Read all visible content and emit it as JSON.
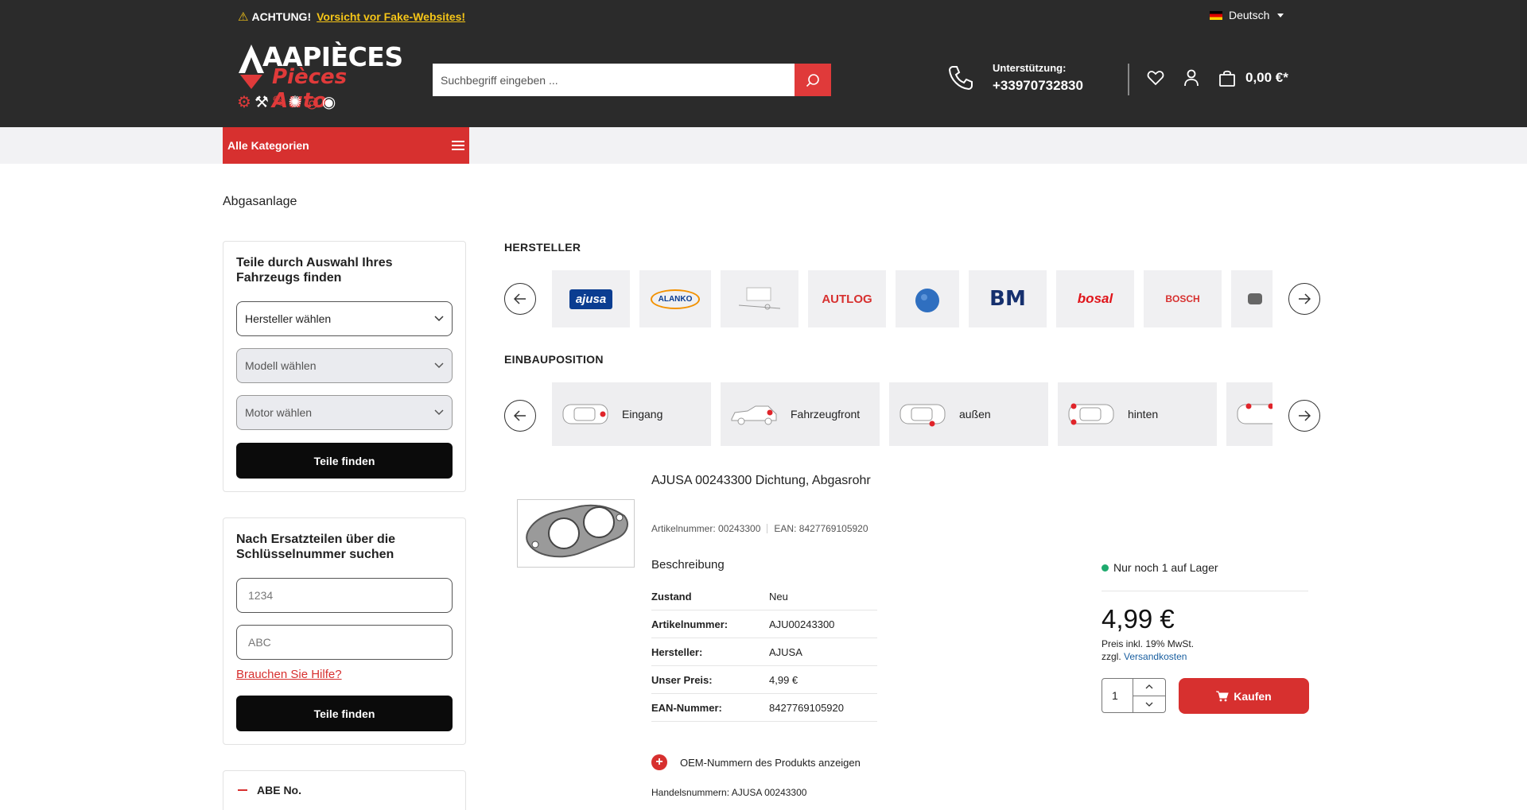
{
  "topbar": {
    "warning_label": "ACHTUNG!",
    "warning_link": "Vorsicht vor Fake-Websites!",
    "language": "Deutsch"
  },
  "logo": {
    "title": "AAPIÈCES",
    "subtitle": "Pièces Auto"
  },
  "search": {
    "placeholder": "Suchbegriff eingeben ..."
  },
  "support": {
    "label": "Unterstützung:",
    "phone": "+33970732830"
  },
  "cart": {
    "total": "0,00 €*"
  },
  "nav": {
    "all_categories": "Alle Kategorien"
  },
  "page": {
    "title": "Abgasanlage"
  },
  "vehicle_finder": {
    "heading": "Teile durch Auswahl Ihres Fahrzeugs finden",
    "manufacturer": "Hersteller wählen",
    "model": "Modell wählen",
    "engine": "Motor wählen",
    "button": "Teile finden"
  },
  "key_finder": {
    "heading": "Nach Ersatzteilen über die Schlüsselnummer suchen",
    "field1_placeholder": "1234",
    "field2_placeholder": "ABC",
    "help": "Brauchen Sie Hilfe?",
    "button": "Teile finden"
  },
  "abe": {
    "label": "ABE No."
  },
  "manufacturers": {
    "label": "HERSTELLER",
    "items": [
      "ajusa",
      "ALANKO",
      "",
      "AUTLOG",
      "BLUE PRINT",
      "BM",
      "bosal",
      "BOSCH",
      ""
    ]
  },
  "positions": {
    "label": "EINBAUPOSITION",
    "items": [
      "Eingang",
      "Fahrzeugfront",
      "außen",
      "hinten",
      ""
    ]
  },
  "product": {
    "title": "AJUSA 00243300 Dichtung, Abgasrohr",
    "article_meta": "Artikelnummer: 00243300",
    "ean_meta": "EAN: 8427769105920",
    "description_heading": "Beschreibung",
    "specs": [
      {
        "key": "Zustand",
        "value": "Neu"
      },
      {
        "key": "Artikelnummer:",
        "value": "AJU00243300"
      },
      {
        "key": "Hersteller:",
        "value": "AJUSA"
      },
      {
        "key": "Unser Preis:",
        "value": "4,99 €"
      },
      {
        "key": "EAN-Nummer:",
        "value": "8427769105920"
      }
    ],
    "oem_toggle": "OEM-Nummern des Produkts anzeigen",
    "trade_numbers": "Handelsnummern: AJUSA 00243300",
    "stock": "Nur noch 1 auf Lager",
    "price": "4,99 €",
    "tax_note": "Preis inkl. 19% MwSt.",
    "shipping_prefix": "zzgl.",
    "shipping_link": "Versandkosten",
    "quantity": "1",
    "buy_label": "Kaufen"
  },
  "colors": {
    "header_bg": "#2b2b2b",
    "accent_red": "#d7302f",
    "warning_yellow": "#f5c518",
    "stock_green": "#1eaa6e"
  }
}
